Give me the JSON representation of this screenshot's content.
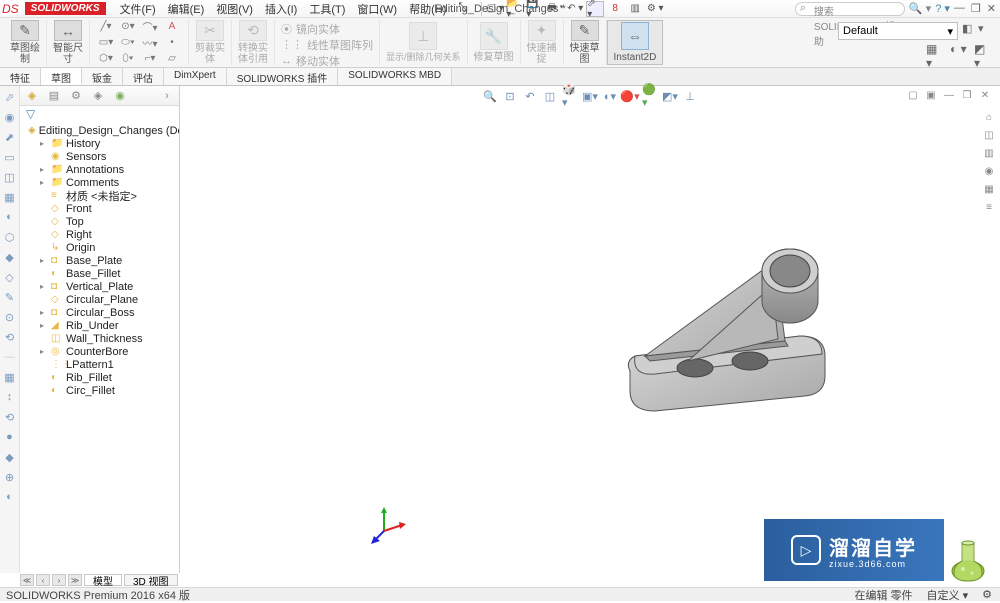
{
  "app": {
    "name": "SOLIDWORKS",
    "ds_prefix": "DS"
  },
  "menus": [
    "文件(F)",
    "编辑(E)",
    "视图(V)",
    "插入(I)",
    "工具(T)",
    "窗口(W)",
    "帮助(H)"
  ],
  "doc_title": "Editing_Design_Changes *",
  "search": {
    "placeholder": "搜索 SOLIDWORKS 帮助"
  },
  "ribbon": {
    "sketch": "草图绘\n制",
    "smartdim": "智能尺\n寸",
    "trim": "剪裁实\n体",
    "convert": "转换实\n体引用",
    "mirror": "镜向实体",
    "pattern": "线性草图阵列",
    "move": "移动实体",
    "show": "显示/删除几何关系",
    "repair": "修复草图",
    "quick_snap": "快速捕\n捉",
    "rapid_sketch": "快速草\n图",
    "instant2d": "Instant2D"
  },
  "style": {
    "default": "Default"
  },
  "tabs": [
    "特征",
    "草图",
    "钣金",
    "评估",
    "DimXpert",
    "SOLIDWORKS 插件",
    "SOLIDWORKS MBD"
  ],
  "active_tab": 1,
  "feature_tree": {
    "root": "Editing_Design_Changes  (Default<<D",
    "items": [
      {
        "label": "History",
        "exp": true,
        "ico": "📁",
        "cls": "ico-folder"
      },
      {
        "label": "Sensors",
        "exp": false,
        "ico": "◉",
        "cls": "ico-blue"
      },
      {
        "label": "Annotations",
        "exp": true,
        "ico": "📁",
        "cls": "ico-folder"
      },
      {
        "label": "Comments",
        "exp": true,
        "ico": "📁",
        "cls": "ico-folder"
      },
      {
        "label": "材质 <未指定>",
        "exp": false,
        "ico": "≡",
        "cls": "ico-gray"
      },
      {
        "label": "Front",
        "exp": false,
        "ico": "◇",
        "cls": "ico-gray"
      },
      {
        "label": "Top",
        "exp": false,
        "ico": "◇",
        "cls": "ico-gray"
      },
      {
        "label": "Right",
        "exp": false,
        "ico": "◇",
        "cls": "ico-gray"
      },
      {
        "label": "Origin",
        "exp": false,
        "ico": "↳",
        "cls": "ico-gray"
      },
      {
        "label": "Base_Plate",
        "exp": true,
        "ico": "◘",
        "cls": "ico-blue"
      },
      {
        "label": "Base_Fillet",
        "exp": false,
        "ico": "◐",
        "cls": "ico-blue"
      },
      {
        "label": "Vertical_Plate",
        "exp": true,
        "ico": "◘",
        "cls": "ico-blue"
      },
      {
        "label": "Circular_Plane",
        "exp": false,
        "ico": "◇",
        "cls": "ico-gray"
      },
      {
        "label": "Circular_Boss",
        "exp": true,
        "ico": "◘",
        "cls": "ico-blue"
      },
      {
        "label": "Rib_Under",
        "exp": true,
        "ico": "◢",
        "cls": "ico-green"
      },
      {
        "label": "Wall_Thickness",
        "exp": false,
        "ico": "◫",
        "cls": "ico-purple"
      },
      {
        "label": "CounterBore",
        "exp": true,
        "ico": "◎",
        "cls": "ico-blue"
      },
      {
        "label": "LPattern1",
        "exp": false,
        "ico": "⋮⋮",
        "cls": "ico-blue"
      },
      {
        "label": "Rib_Fillet",
        "exp": false,
        "ico": "◐",
        "cls": "ico-blue"
      },
      {
        "label": "Circ_Fillet",
        "exp": false,
        "ico": "◐",
        "cls": "ico-blue"
      }
    ]
  },
  "bottom_tabs": [
    "模型",
    "3D 视图"
  ],
  "status": {
    "version": "SOLIDWORKS Premium 2016 x64 版",
    "edit": "在编辑 零件",
    "custom": "自定义"
  },
  "watermark": {
    "main": "溜溜自学",
    "sub": "zixue.3d66.com"
  }
}
